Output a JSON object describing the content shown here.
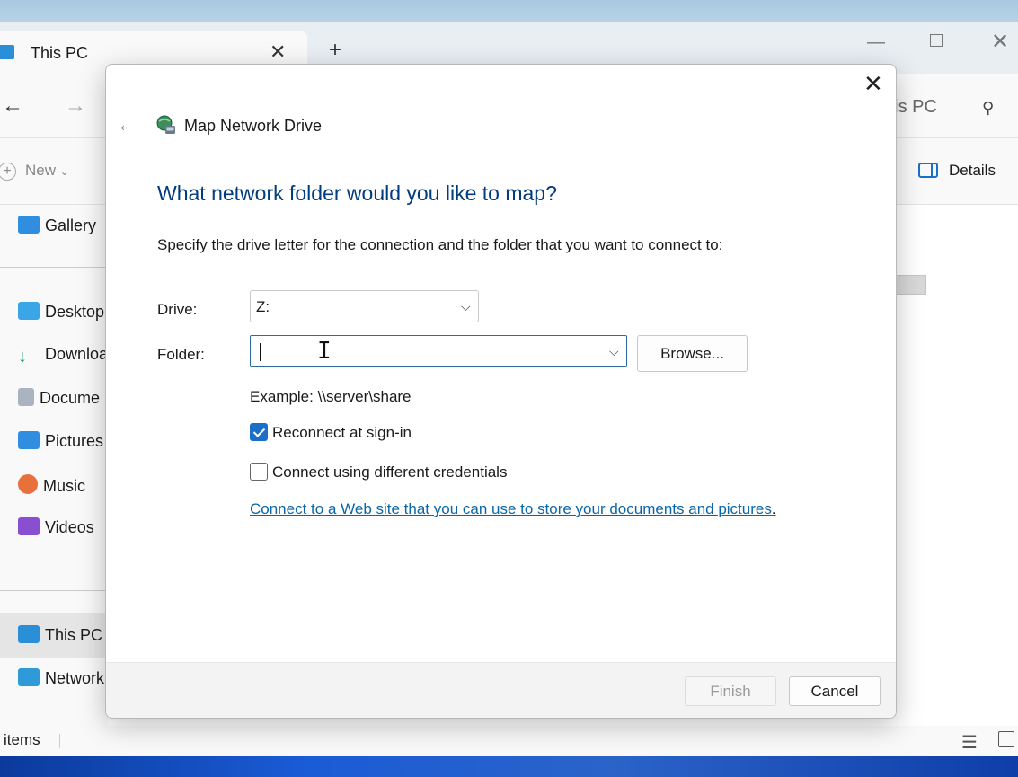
{
  "explorer": {
    "tab_title": "This PC",
    "breadcrumb": "his PC",
    "toolbar": {
      "new_label": "New",
      "details_label": "Details"
    },
    "sidebar": {
      "items": [
        {
          "label": "Gallery"
        },
        {
          "label": "Desktop"
        },
        {
          "label": "Downloa"
        },
        {
          "label": "Docume"
        },
        {
          "label": "Pictures"
        },
        {
          "label": "Music"
        },
        {
          "label": "Videos"
        },
        {
          "label": "This PC"
        },
        {
          "label": "Network"
        }
      ],
      "selected": "This PC"
    },
    "status": {
      "text": "items"
    }
  },
  "dialog": {
    "title": "Map Network Drive",
    "heading": "What network folder would you like to map?",
    "description": "Specify the drive letter for the connection and the folder that you want to connect to:",
    "drive_label": "Drive:",
    "drive_value": "Z:",
    "folder_label": "Folder:",
    "folder_value": "",
    "browse_label": "Browse...",
    "example": "Example: \\\\server\\share",
    "reconnect_label": "Reconnect at sign-in",
    "reconnect_checked": true,
    "credentials_label": "Connect using different credentials",
    "credentials_checked": false,
    "link_text": "Connect to a Web site that you can use to store your documents and pictures",
    "link_suffix": ".",
    "finish_label": "Finish",
    "finish_enabled": false,
    "cancel_label": "Cancel"
  },
  "colors": {
    "accent": "#1b6fc8",
    "heading": "#003c7e",
    "link": "#0b66a8"
  }
}
